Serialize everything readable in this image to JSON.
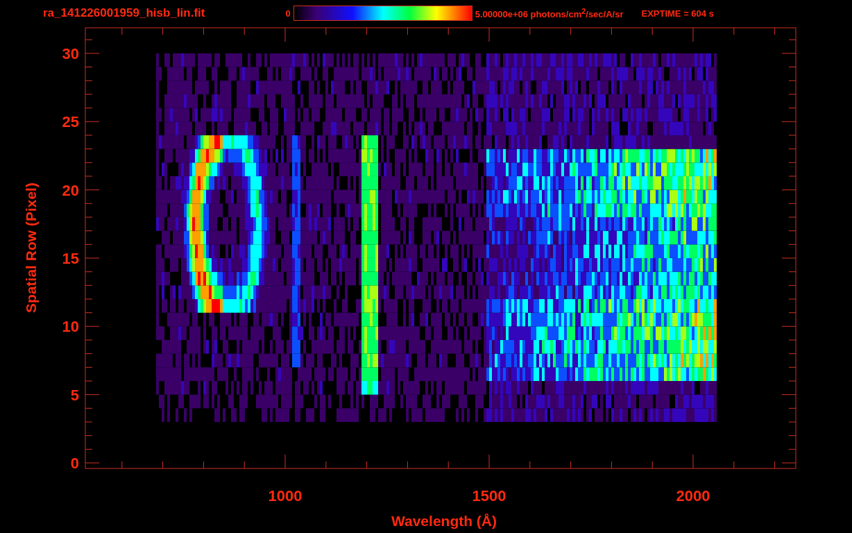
{
  "title": "ra_141226001959_hisb_lin.fit",
  "colorbar": {
    "min_label": "0",
    "max_label": "5.00000e+06 photons/cm$^{2}$/sec/A/sr"
  },
  "exposure": "EXPTIME = 604 s",
  "plot": {
    "xlabel": "Wavelength (Å)",
    "ylabel": "Spatial Row (Pixel)",
    "xticks": [
      "1000",
      "1500",
      "2000"
    ],
    "yticks": [
      "30",
      "25",
      "20",
      "15",
      "10",
      "5",
      "0"
    ]
  }
}
